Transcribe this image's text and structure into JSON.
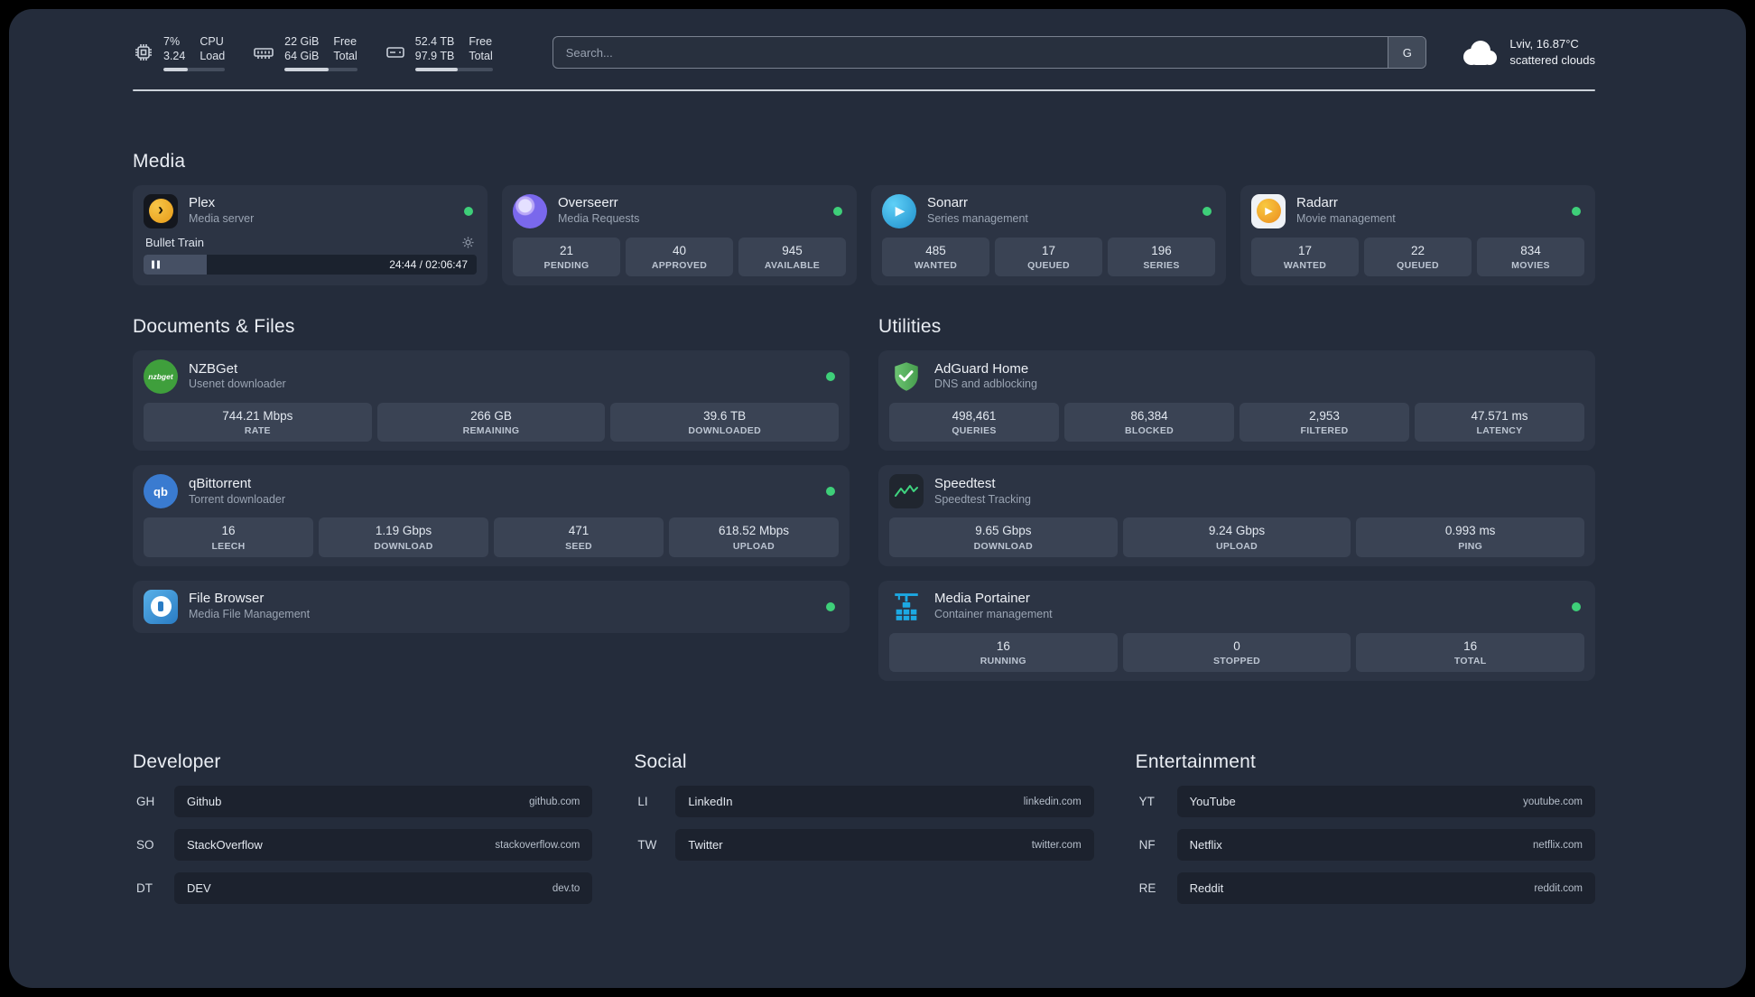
{
  "topbar": {
    "cpu": {
      "value1": "7%",
      "value2": "3.24",
      "label1": "CPU",
      "label2": "Load",
      "bar": 40
    },
    "memory": {
      "value1": "22 GiB",
      "value2": "64 GiB",
      "label1": "Free",
      "label2": "Total",
      "bar": 60
    },
    "disk": {
      "value1": "52.4 TB",
      "value2": "97.9 TB",
      "label1": "Free",
      "label2": "Total",
      "bar": 55
    },
    "search": {
      "placeholder": "Search...",
      "provider_label": "G"
    },
    "weather": {
      "location": "Lviv, 16.87°C",
      "condition": "scattered clouds"
    }
  },
  "sections": {
    "media": {
      "title": "Media",
      "plex": {
        "name": "Plex",
        "subtitle": "Media server",
        "track": "Bullet Train",
        "time": "24:44 / 02:06:47",
        "progress": 19
      },
      "overseerr": {
        "name": "Overseerr",
        "subtitle": "Media Requests",
        "stats": [
          {
            "value": "21",
            "label": "PENDING"
          },
          {
            "value": "40",
            "label": "APPROVED"
          },
          {
            "value": "945",
            "label": "AVAILABLE"
          }
        ]
      },
      "sonarr": {
        "name": "Sonarr",
        "subtitle": "Series management",
        "stats": [
          {
            "value": "485",
            "label": "WANTED"
          },
          {
            "value": "17",
            "label": "QUEUED"
          },
          {
            "value": "196",
            "label": "SERIES"
          }
        ]
      },
      "radarr": {
        "name": "Radarr",
        "subtitle": "Movie management",
        "stats": [
          {
            "value": "17",
            "label": "WANTED"
          },
          {
            "value": "22",
            "label": "QUEUED"
          },
          {
            "value": "834",
            "label": "MOVIES"
          }
        ]
      }
    },
    "documents": {
      "title": "Documents & Files",
      "nzbget": {
        "name": "NZBGet",
        "subtitle": "Usenet downloader",
        "stats": [
          {
            "value": "744.21 Mbps",
            "label": "RATE"
          },
          {
            "value": "266 GB",
            "label": "REMAINING"
          },
          {
            "value": "39.6 TB",
            "label": "DOWNLOADED"
          }
        ]
      },
      "qbittorrent": {
        "name": "qBittorrent",
        "subtitle": "Torrent downloader",
        "stats": [
          {
            "value": "16",
            "label": "LEECH"
          },
          {
            "value": "1.19 Gbps",
            "label": "DOWNLOAD"
          },
          {
            "value": "471",
            "label": "SEED"
          },
          {
            "value": "618.52 Mbps",
            "label": "UPLOAD"
          }
        ]
      },
      "filebrowser": {
        "name": "File Browser",
        "subtitle": "Media File Management"
      }
    },
    "utilities": {
      "title": "Utilities",
      "adguard": {
        "name": "AdGuard Home",
        "subtitle": "DNS and adblocking",
        "stats": [
          {
            "value": "498,461",
            "label": "QUERIES"
          },
          {
            "value": "86,384",
            "label": "BLOCKED"
          },
          {
            "value": "2,953",
            "label": "FILTERED"
          },
          {
            "value": "47.571 ms",
            "label": "LATENCY"
          }
        ]
      },
      "speedtest": {
        "name": "Speedtest",
        "subtitle": "Speedtest Tracking",
        "stats": [
          {
            "value": "9.65 Gbps",
            "label": "DOWNLOAD"
          },
          {
            "value": "9.24 Gbps",
            "label": "UPLOAD"
          },
          {
            "value": "0.993 ms",
            "label": "PING"
          }
        ]
      },
      "portainer": {
        "name": "Media Portainer",
        "subtitle": "Container management",
        "stats": [
          {
            "value": "16",
            "label": "RUNNING"
          },
          {
            "value": "0",
            "label": "STOPPED"
          },
          {
            "value": "16",
            "label": "TOTAL"
          }
        ]
      }
    }
  },
  "bookmarks": {
    "developer": {
      "title": "Developer",
      "items": [
        {
          "abbr": "GH",
          "name": "Github",
          "domain": "github.com"
        },
        {
          "abbr": "SO",
          "name": "StackOverflow",
          "domain": "stackoverflow.com"
        },
        {
          "abbr": "DT",
          "name": "DEV",
          "domain": "dev.to"
        }
      ]
    },
    "social": {
      "title": "Social",
      "items": [
        {
          "abbr": "LI",
          "name": "LinkedIn",
          "domain": "linkedin.com"
        },
        {
          "abbr": "TW",
          "name": "Twitter",
          "domain": "twitter.com"
        }
      ]
    },
    "entertainment": {
      "title": "Entertainment",
      "items": [
        {
          "abbr": "YT",
          "name": "YouTube",
          "domain": "youtube.com"
        },
        {
          "abbr": "NF",
          "name": "Netflix",
          "domain": "netflix.com"
        },
        {
          "abbr": "RE",
          "name": "Reddit",
          "domain": "reddit.com"
        }
      ]
    }
  },
  "icons": {
    "plex_glyph": "›",
    "play_glyph": "▶",
    "nzbget_text": "nzbget",
    "qbittorrent_text": "qb"
  },
  "colors": {
    "status_online": "#3ecf79",
    "accent_green": "#3fd37f",
    "portainer_blue": "#1ca9e3"
  }
}
